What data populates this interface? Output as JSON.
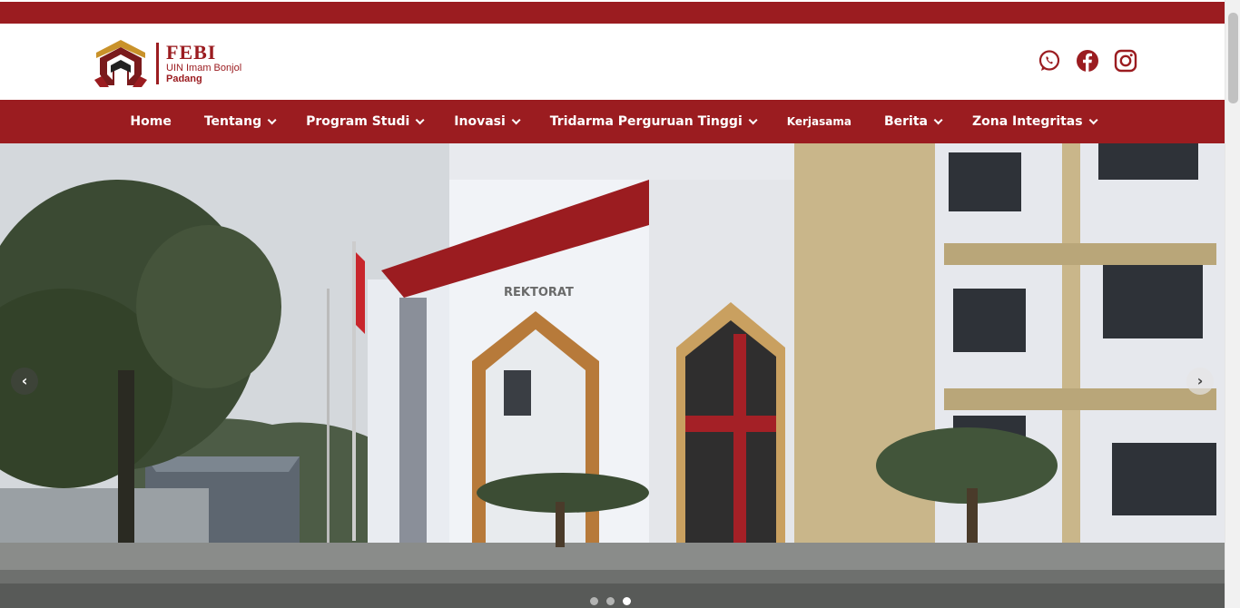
{
  "header": {
    "logo_title": "FEBI",
    "logo_sub1": "UIN Imam Bonjol",
    "logo_sub2": "Padang",
    "socials": [
      {
        "name": "whatsapp-icon"
      },
      {
        "name": "facebook-icon"
      },
      {
        "name": "instagram-icon"
      }
    ]
  },
  "nav": {
    "items": [
      {
        "label": "Home",
        "dropdown": false
      },
      {
        "label": "Tentang",
        "dropdown": true
      },
      {
        "label": "Program Studi",
        "dropdown": true
      },
      {
        "label": "Inovasi",
        "dropdown": true
      },
      {
        "label": "Tridarma Perguruan Tinggi",
        "dropdown": true
      },
      {
        "label": "Kerjasama",
        "dropdown": false
      },
      {
        "label": "Berita",
        "dropdown": true
      },
      {
        "label": "Zona Integritas",
        "dropdown": true
      }
    ]
  },
  "hero": {
    "building_sign": "REKTORAT",
    "prev_label": "‹",
    "next_label": "›",
    "slides_count": 3,
    "active_slide": 3
  },
  "colors": {
    "brand_red": "#9b1c20",
    "nav_text": "#ffffff"
  }
}
